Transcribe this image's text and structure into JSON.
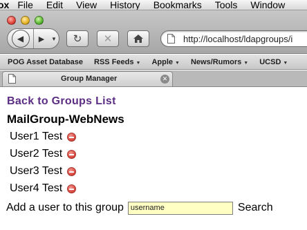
{
  "menubar": {
    "app": "ox",
    "items": [
      "File",
      "Edit",
      "View",
      "History",
      "Bookmarks",
      "Tools",
      "Window"
    ]
  },
  "toolbar": {
    "url": "http://localhost/ldapgroups/i"
  },
  "bookmarks": [
    {
      "label": "POG Asset Database",
      "has_menu": false
    },
    {
      "label": "RSS Feeds",
      "has_menu": true
    },
    {
      "label": "Apple",
      "has_menu": true
    },
    {
      "label": "News/Rumors",
      "has_menu": true
    },
    {
      "label": "UCSD",
      "has_menu": true
    }
  ],
  "tab": {
    "title": "Group Manager"
  },
  "page": {
    "back_link": "Back to Groups List",
    "group_title": "MailGroup-WebNews",
    "users": [
      "User1 Test",
      "User2 Test",
      "User3 Test",
      "User4 Test"
    ],
    "add_label": "Add a user to this group",
    "add_input_value": "username",
    "add_button": "Search"
  },
  "colors": {
    "link": "#5b2d83",
    "input_bg": "#ffffc4",
    "remove_icon": "#d9463d"
  }
}
